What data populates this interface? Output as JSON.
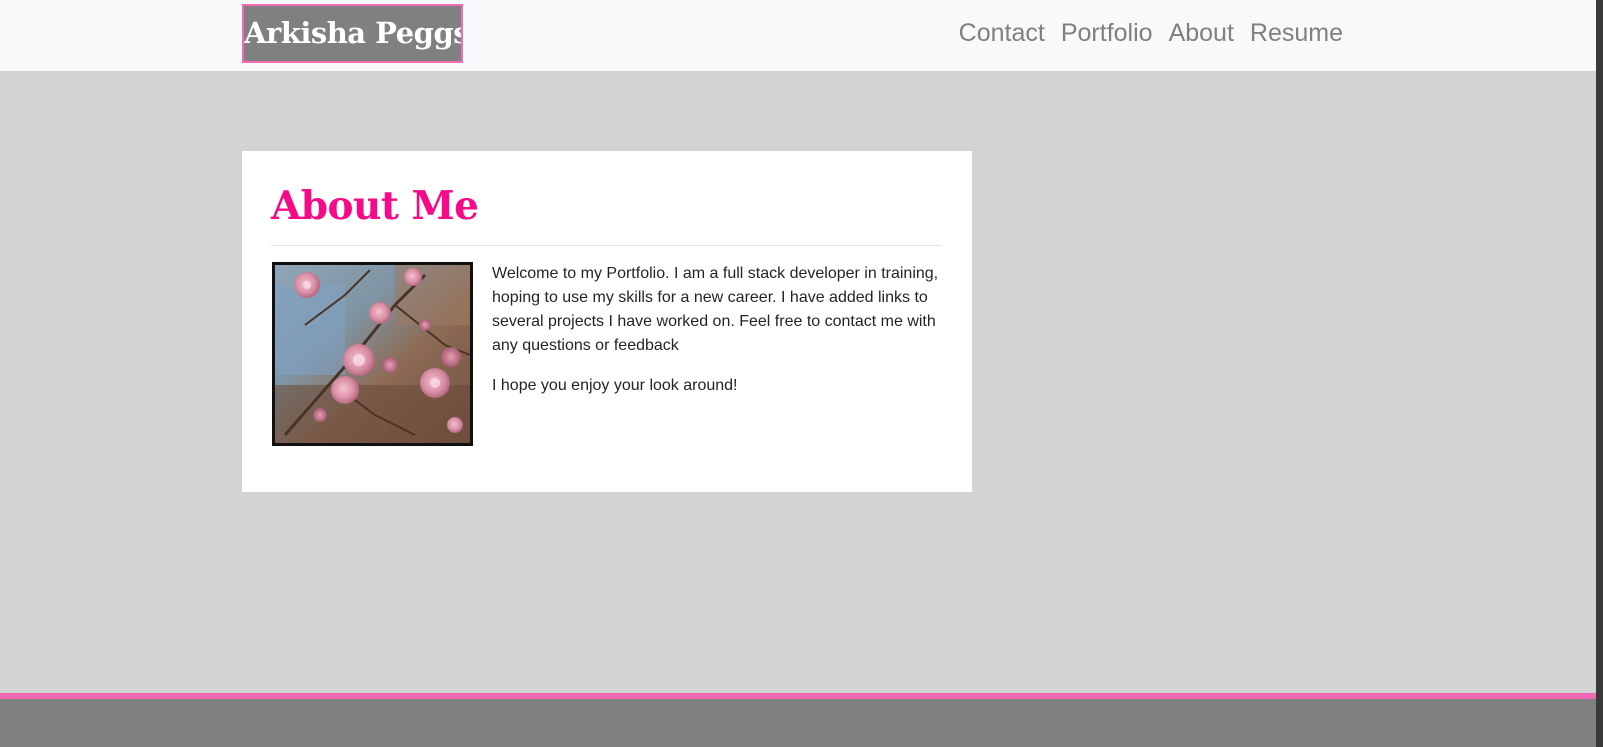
{
  "header": {
    "brand": "Arkisha Peggs",
    "nav": [
      "Contact",
      "Portfolio",
      "About",
      "Resume"
    ]
  },
  "about": {
    "title": "About Me",
    "paragraphs": [
      "Welcome to my Portfolio. I am a full stack developer in training, hoping to use my skills for a new career. I have added links to several projects I have worked on. Feel free to contact me with any questions or feedback",
      "I hope you enjoy your look around!"
    ],
    "photo_subject": "pink roses"
  },
  "colors": {
    "accent_pink": "#f50a87",
    "border_pink": "#f06bb1",
    "page_background": "#d3d3d3",
    "navbar_background": "#f8f9fa",
    "footer_background": "#808080"
  }
}
